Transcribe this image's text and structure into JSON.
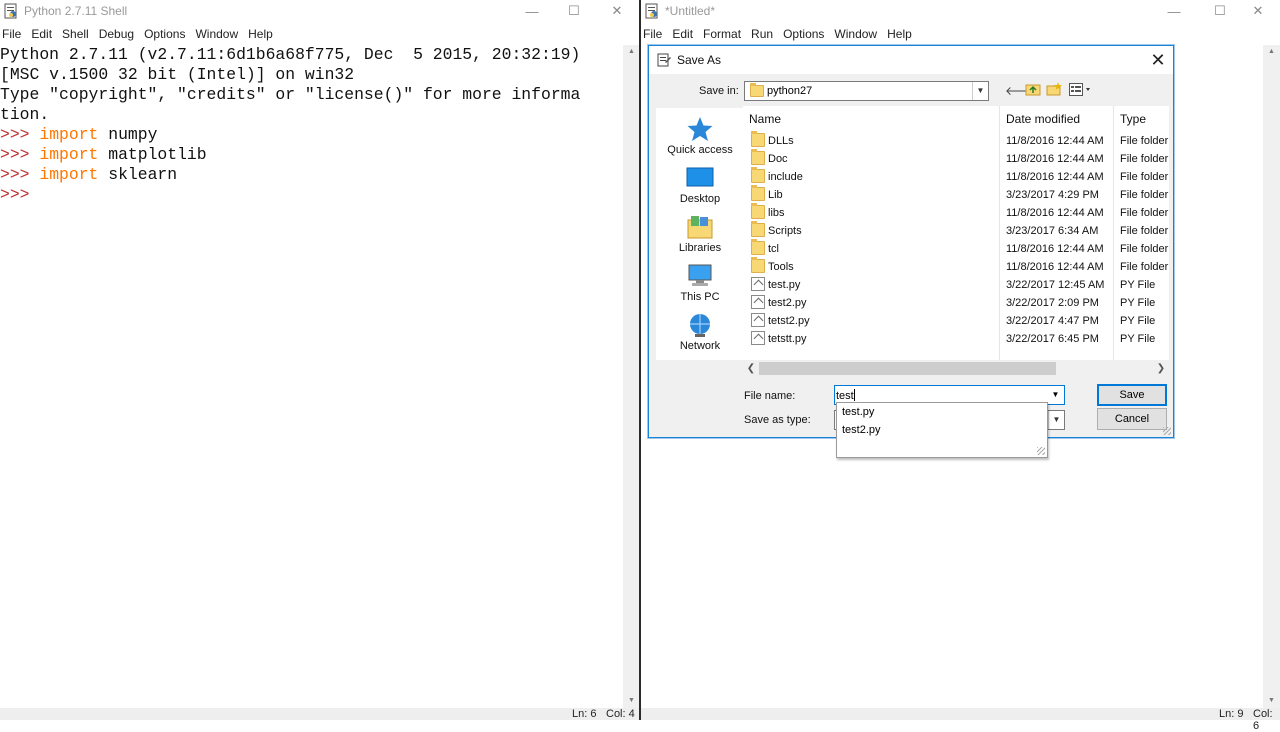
{
  "shell": {
    "title": "Python 2.7.11 Shell",
    "menu": [
      "File",
      "Edit",
      "Shell",
      "Debug",
      "Options",
      "Window",
      "Help"
    ],
    "console_lines": [
      {
        "prefix": "",
        "keyword": "",
        "text": "Python 2.7.11 (v2.7.11:6d1b6a68f775, Dec  5 2015, 20:32:19)"
      },
      {
        "prefix": "",
        "keyword": "",
        "text": "[MSC v.1500 32 bit (Intel)] on win32"
      },
      {
        "prefix": "",
        "keyword": "",
        "text": "Type \"copyright\", \"credits\" or \"license()\" for more informa"
      },
      {
        "prefix": "",
        "keyword": "",
        "text": "tion."
      },
      {
        "prefix": ">>> ",
        "keyword": "import",
        "text": " numpy"
      },
      {
        "prefix": ">>> ",
        "keyword": "import",
        "text": " matplotlib"
      },
      {
        "prefix": ">>> ",
        "keyword": "import",
        "text": " sklearn"
      },
      {
        "prefix": ">>> ",
        "keyword": "",
        "text": ""
      }
    ],
    "status": {
      "ln": "Ln: 6",
      "col": "Col: 4"
    }
  },
  "editor": {
    "title": "*Untitled*",
    "menu": [
      "File",
      "Edit",
      "Format",
      "Run",
      "Options",
      "Window",
      "Help"
    ],
    "status": {
      "ln": "Ln: 9",
      "col": "Col: 6"
    }
  },
  "dialog": {
    "title": "Save As",
    "save_in_label": "Save in:",
    "save_in_value": "python27",
    "places": [
      "Quick access",
      "Desktop",
      "Libraries",
      "This PC",
      "Network"
    ],
    "columns": {
      "name": "Name",
      "date": "Date modified",
      "type": "Type"
    },
    "files": [
      {
        "name": "DLLs",
        "date": "11/8/2016 12:44 AM",
        "type": "File folder",
        "kind": "folder"
      },
      {
        "name": "Doc",
        "date": "11/8/2016 12:44 AM",
        "type": "File folder",
        "kind": "folder"
      },
      {
        "name": "include",
        "date": "11/8/2016 12:44 AM",
        "type": "File folder",
        "kind": "folder"
      },
      {
        "name": "Lib",
        "date": "3/23/2017 4:29 PM",
        "type": "File folder",
        "kind": "folder"
      },
      {
        "name": "libs",
        "date": "11/8/2016 12:44 AM",
        "type": "File folder",
        "kind": "folder"
      },
      {
        "name": "Scripts",
        "date": "3/23/2017 6:34 AM",
        "type": "File folder",
        "kind": "folder"
      },
      {
        "name": "tcl",
        "date": "11/8/2016 12:44 AM",
        "type": "File folder",
        "kind": "folder"
      },
      {
        "name": "Tools",
        "date": "11/8/2016 12:44 AM",
        "type": "File folder",
        "kind": "folder"
      },
      {
        "name": "test.py",
        "date": "3/22/2017 12:45 AM",
        "type": "PY File",
        "kind": "py"
      },
      {
        "name": "test2.py",
        "date": "3/22/2017 2:09 PM",
        "type": "PY File",
        "kind": "py"
      },
      {
        "name": "tetst2.py",
        "date": "3/22/2017 4:47 PM",
        "type": "PY File",
        "kind": "py"
      },
      {
        "name": "tetstt.py",
        "date": "3/22/2017 6:45 PM",
        "type": "PY File",
        "kind": "py"
      }
    ],
    "file_name_label": "File name:",
    "file_name_value": "test",
    "save_as_type_label": "Save as type:",
    "save_button": "Save",
    "cancel_button": "Cancel",
    "autocomplete": [
      "test.py",
      "test2.py"
    ]
  },
  "colors": {
    "accent": "#0078d7",
    "keyword": "#ff7700"
  }
}
